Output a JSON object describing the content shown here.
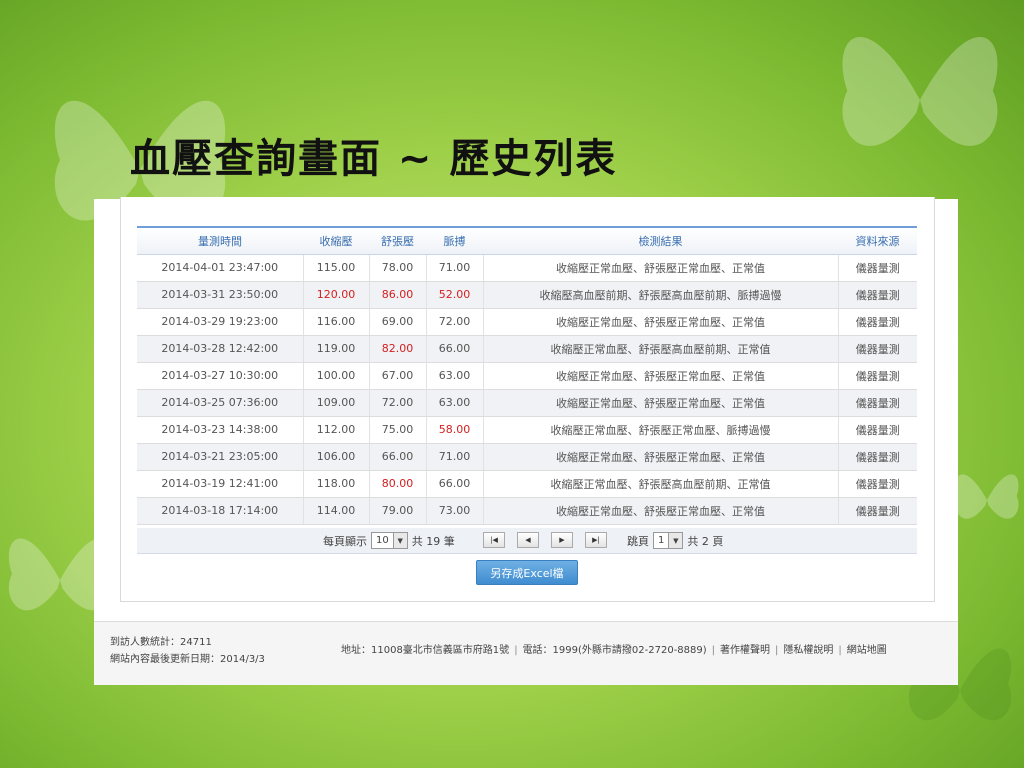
{
  "slide_title": "血壓查詢畫面 ~ 歷史列表",
  "table": {
    "headers": [
      "量測時間",
      "收縮壓",
      "舒張壓",
      "脈搏",
      "檢測結果",
      "資料來源"
    ],
    "rows": [
      {
        "time": "2014-04-01 23:47:00",
        "sys": "115.00",
        "dia": "78.00",
        "pulse": "71.00",
        "result": "收縮壓正常血壓、舒張壓正常血壓、正常值",
        "source": "儀器量測"
      },
      {
        "time": "2014-03-31 23:50:00",
        "sys": "120.00",
        "dia": "86.00",
        "pulse": "52.00",
        "result": "收縮壓高血壓前期、舒張壓高血壓前期、脈搏過慢",
        "source": "儀器量測"
      },
      {
        "time": "2014-03-29 19:23:00",
        "sys": "116.00",
        "dia": "69.00",
        "pulse": "72.00",
        "result": "收縮壓正常血壓、舒張壓正常血壓、正常值",
        "source": "儀器量測"
      },
      {
        "time": "2014-03-28 12:42:00",
        "sys": "119.00",
        "dia": "82.00",
        "pulse": "66.00",
        "result": "收縮壓正常血壓、舒張壓高血壓前期、正常值",
        "source": "儀器量測"
      },
      {
        "time": "2014-03-27 10:30:00",
        "sys": "100.00",
        "dia": "67.00",
        "pulse": "63.00",
        "result": "收縮壓正常血壓、舒張壓正常血壓、正常值",
        "source": "儀器量測"
      },
      {
        "time": "2014-03-25 07:36:00",
        "sys": "109.00",
        "dia": "72.00",
        "pulse": "63.00",
        "result": "收縮壓正常血壓、舒張壓正常血壓、正常值",
        "source": "儀器量測"
      },
      {
        "time": "2014-03-23 14:38:00",
        "sys": "112.00",
        "dia": "75.00",
        "pulse": "58.00",
        "result": "收縮壓正常血壓、舒張壓正常血壓、脈搏過慢",
        "source": "儀器量測"
      },
      {
        "time": "2014-03-21 23:05:00",
        "sys": "106.00",
        "dia": "66.00",
        "pulse": "71.00",
        "result": "收縮壓正常血壓、舒張壓正常血壓、正常值",
        "source": "儀器量測"
      },
      {
        "time": "2014-03-19 12:41:00",
        "sys": "118.00",
        "dia": "80.00",
        "pulse": "66.00",
        "result": "收縮壓正常血壓、舒張壓高血壓前期、正常值",
        "source": "儀器量測"
      },
      {
        "time": "2014-03-18 17:14:00",
        "sys": "114.00",
        "dia": "79.00",
        "pulse": "73.00",
        "result": "收縮壓正常血壓、舒張壓正常血壓、正常值",
        "source": "儀器量測"
      }
    ],
    "highlighted_red": [
      {
        "row": 1,
        "fields": [
          "sys",
          "dia",
          "pulse"
        ]
      },
      {
        "row": 3,
        "fields": [
          "dia"
        ]
      },
      {
        "row": 6,
        "fields": [
          "pulse"
        ]
      },
      {
        "row": 8,
        "fields": [
          "dia"
        ]
      }
    ],
    "highlight_color": "#d42020"
  },
  "pager": {
    "per_page_label": "每頁顯示",
    "per_page_value": "10",
    "total_records": "共 19 筆",
    "jump_label": "跳頁",
    "page_value": "1",
    "total_pages": "共 2 頁",
    "nav_icons": [
      "first-page-icon",
      "prev-page-icon",
      "next-page-icon",
      "last-page-icon"
    ]
  },
  "export_button_label": "另存成Excel檔",
  "footer": {
    "visitors": "到訪人數統計：24711",
    "last_updated": "網站內容最後更新日期：2014/3/3",
    "address": "地址：11008臺北市信義區市府路1號",
    "phone": "電話：1999(外縣市請撥02-2720-8889)",
    "links": [
      "著作權聲明",
      "隱私權說明",
      "網站地圖"
    ]
  },
  "colors": {
    "header_text": "#3a6fb0",
    "button": "#3f8cd0",
    "background_green": "#9fd04a"
  }
}
